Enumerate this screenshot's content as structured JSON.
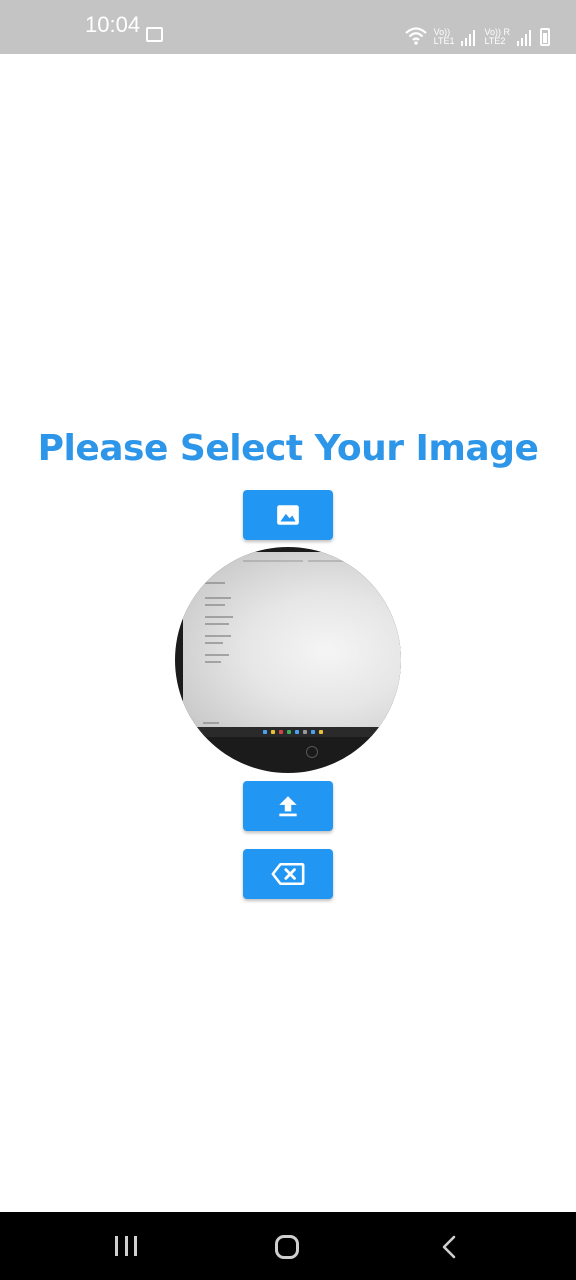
{
  "status_bar": {
    "time": "10:04",
    "sim1_label": "Vo))",
    "sim1_net": "LTE1",
    "sim2_label": "Vo)) R",
    "sim2_net": "LTE2"
  },
  "page": {
    "title": "Please Select Your Image"
  },
  "buttons": {
    "gallery_icon": "image-icon",
    "upload_icon": "upload-icon",
    "clear_icon": "backspace-icon"
  },
  "colors": {
    "accent": "#2196f3",
    "title": "#2d96e8",
    "status_bar": "#c4c4c4",
    "nav_bar": "#000000"
  },
  "nav": {
    "recents_icon": "recents-icon",
    "home_icon": "home-icon",
    "back_icon": "back-icon"
  }
}
